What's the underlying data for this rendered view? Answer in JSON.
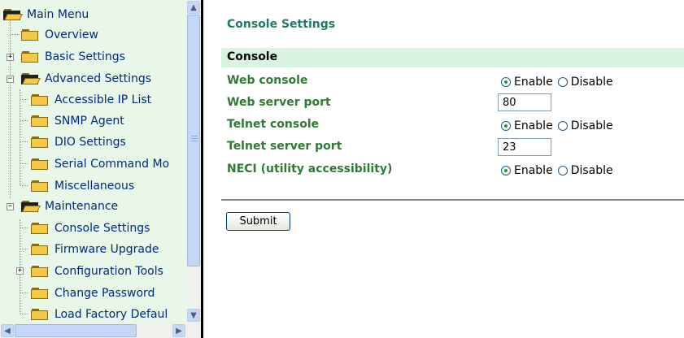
{
  "tree": {
    "items": [
      {
        "label": "Main Menu"
      },
      {
        "label": "Overview"
      },
      {
        "label": "Basic Settings"
      },
      {
        "label": "Advanced Settings"
      },
      {
        "label": "Accessible IP List"
      },
      {
        "label": "SNMP Agent"
      },
      {
        "label": "DIO Settings"
      },
      {
        "label": "Serial Command Mo"
      },
      {
        "label": "Miscellaneous"
      },
      {
        "label": "Maintenance"
      },
      {
        "label": "Console Settings"
      },
      {
        "label": "Firmware Upgrade"
      },
      {
        "label": "Configuration Tools"
      },
      {
        "label": "Change Password"
      },
      {
        "label": "Load Factory Defaul"
      }
    ],
    "expand_glyphs": {
      "plus": "+",
      "minus": "−"
    }
  },
  "page": {
    "title": "Console Settings",
    "section": "Console",
    "fields": [
      {
        "label": "Web console",
        "type": "radio",
        "selected": "Enable"
      },
      {
        "label": "Web server port",
        "type": "text",
        "value": "80"
      },
      {
        "label": "Telnet console",
        "type": "radio",
        "selected": "Enable"
      },
      {
        "label": "Telnet server port",
        "type": "text",
        "value": "23"
      },
      {
        "label": "NECI (utility accessibility)",
        "type": "radio",
        "selected": "Enable"
      }
    ],
    "radio_options": {
      "enable": "Enable",
      "disable": "Disable"
    },
    "submit_label": "Submit"
  },
  "colors": {
    "tree_bg": "#e9f7e9",
    "tree_text": "#002a80",
    "title": "#1f7a6a",
    "section_bar": "#d9f5e2",
    "field_label": "#2f7a34"
  }
}
